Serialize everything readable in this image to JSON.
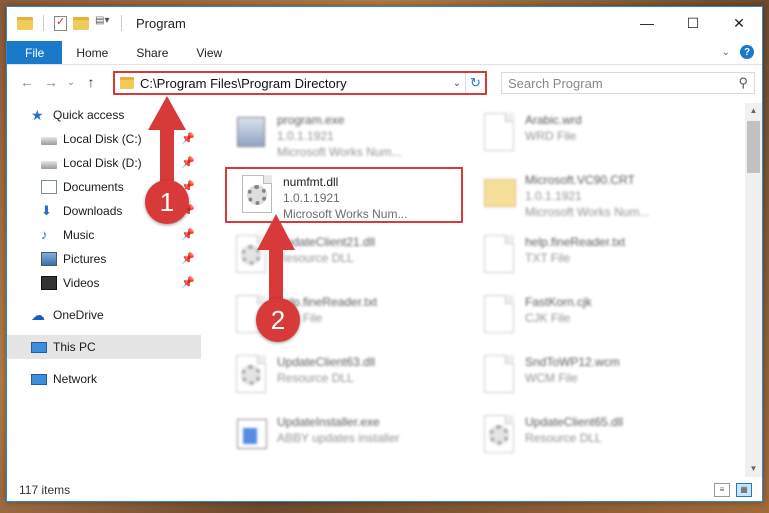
{
  "window": {
    "title": "Program",
    "controls": {
      "minimize": "—",
      "maximize": "☐",
      "close": "✕"
    }
  },
  "ribbon": {
    "tabs": [
      "File",
      "Home",
      "Share",
      "View"
    ],
    "help": "?"
  },
  "nav": {
    "back": "←",
    "forward": "→",
    "recent": "⌄",
    "up": "↑",
    "address": "C:\\Program Files\\Program Directory",
    "search_placeholder": "Search Program"
  },
  "sidebar": {
    "quick_access": "Quick access",
    "items": [
      {
        "label": "Local Disk (C:)",
        "icon": "drive-icon"
      },
      {
        "label": "Local Disk (D:)",
        "icon": "drive-icon"
      },
      {
        "label": "Documents",
        "icon": "documents-icon"
      },
      {
        "label": "Downloads",
        "icon": "download-icon"
      },
      {
        "label": "Music",
        "icon": "music-icon"
      },
      {
        "label": "Pictures",
        "icon": "pictures-icon"
      },
      {
        "label": "Videos",
        "icon": "videos-icon"
      }
    ],
    "onedrive": "OneDrive",
    "this_pc": "This PC",
    "network": "Network"
  },
  "files": [
    {
      "name": "program.exe",
      "line2": "1.0.1.1921",
      "line3": "Microsoft Works Num...",
      "icon": "exe-icon"
    },
    {
      "name": "Arabic.wrd",
      "line2": "WRD File",
      "line3": "",
      "icon": "file-icon"
    },
    {
      "name": "numfmt.dll",
      "line2": "1.0.1.1921",
      "line3": "Microsoft Works Num...",
      "icon": "dll-icon"
    },
    {
      "name": "Microsoft.VC90.CRT",
      "line2": "1.0.1.1921",
      "line3": "Microsoft Works Num...",
      "icon": "folder-icon"
    },
    {
      "name": "UpdateClient21.dll",
      "line2": "Resource DLL",
      "line3": "",
      "icon": "dll-icon"
    },
    {
      "name": "help.fineReader.txt",
      "line2": "TXT File",
      "line3": "",
      "icon": "file-icon"
    },
    {
      "name": "help.fineReader.txt",
      "line2": "TXT File",
      "line3": "",
      "icon": "file-icon"
    },
    {
      "name": "FastKorn.cjk",
      "line2": "CJK File",
      "line3": "",
      "icon": "file-icon"
    },
    {
      "name": "UpdateClient63.dll",
      "line2": "Resource DLL",
      "line3": "",
      "icon": "dll-icon"
    },
    {
      "name": "SndToWP12.wcm",
      "line2": "WCM File",
      "line3": "",
      "icon": "file-icon"
    },
    {
      "name": "UpdateInstaller.exe",
      "line2": "ABBY updates installer",
      "line3": "",
      "icon": "installer-icon"
    },
    {
      "name": "UpdateClient65.dll",
      "line2": "Resource DLL",
      "line3": "",
      "icon": "dll-icon"
    }
  ],
  "status": {
    "items_count": "117 items"
  },
  "annotations": {
    "step1": "1",
    "step2": "2"
  },
  "colors": {
    "accent": "#1979ca",
    "highlight": "#d83a3a"
  }
}
